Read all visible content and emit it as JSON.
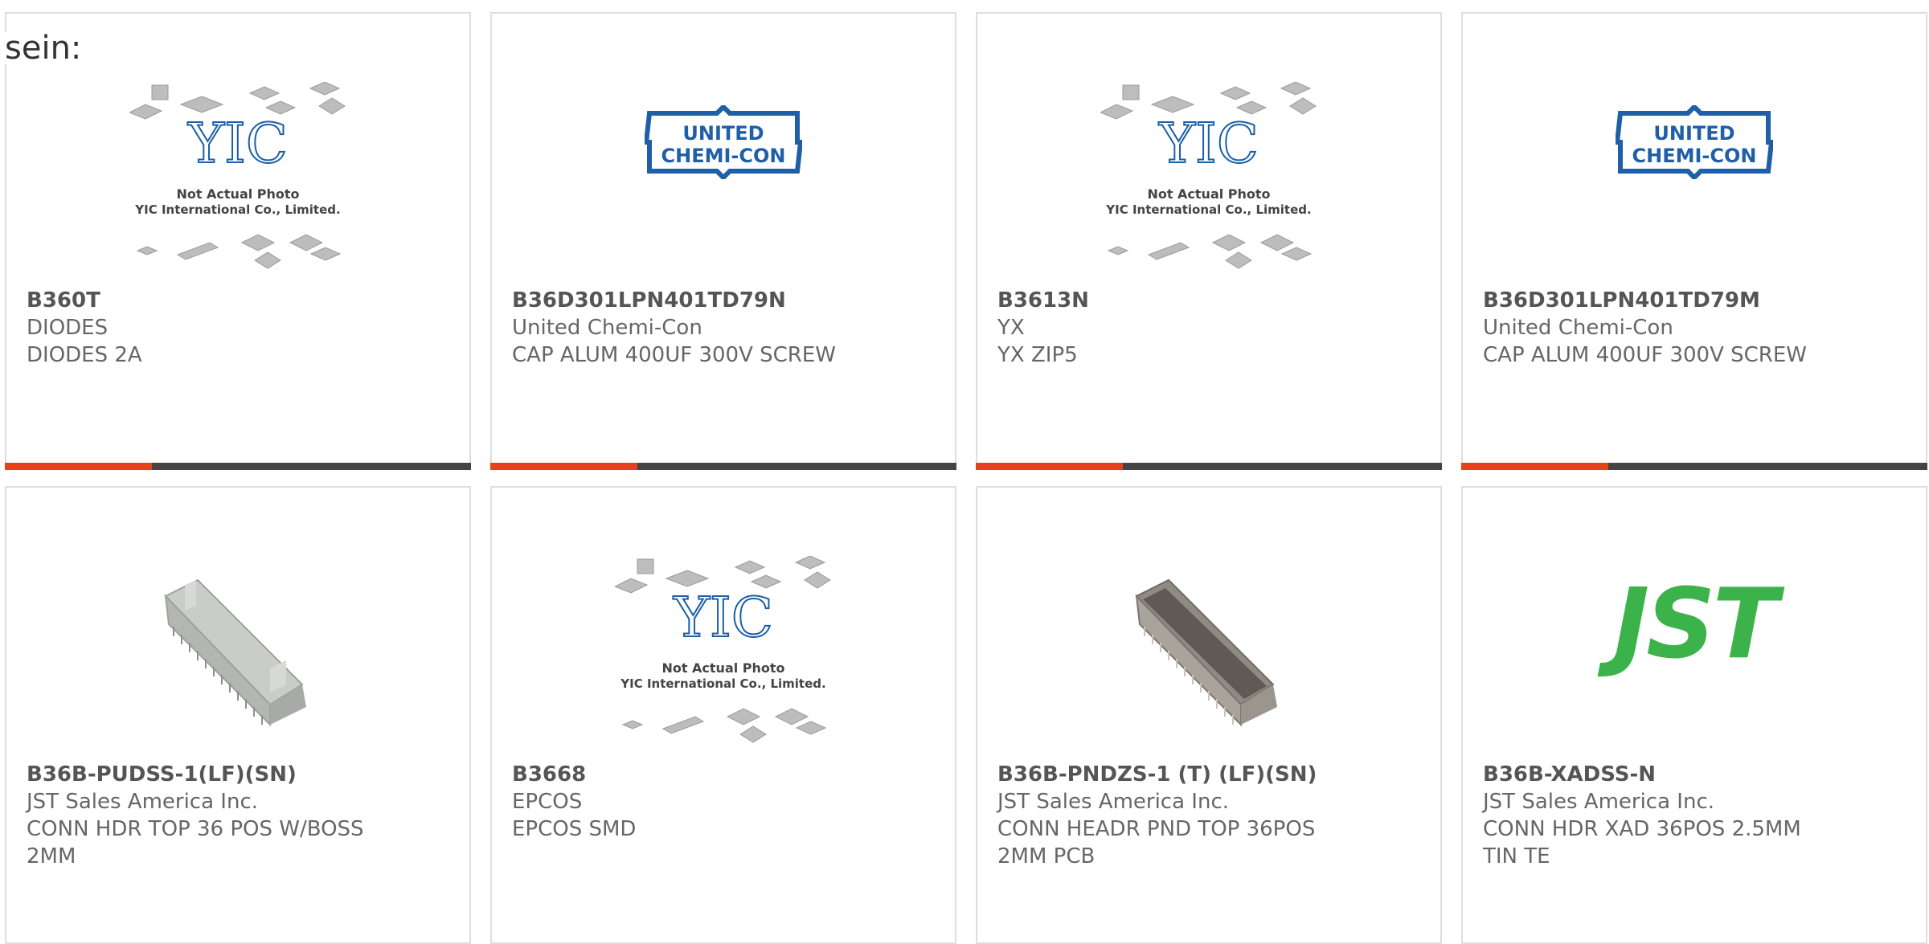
{
  "intro_text": "sein:",
  "logos": {
    "yic_caption_1": "Not Actual Photo",
    "yic_caption_2": "YIC International Co., Limited.",
    "yic_mark": "YIC",
    "chemi_line1": "UNITED",
    "chemi_line2": "CHEMI-CON",
    "jst_mark": "JST"
  },
  "products": [
    {
      "part": "B360T",
      "maker": "DIODES",
      "desc": "DIODES 2A",
      "image": "yic-placeholder"
    },
    {
      "part": "B36D301LPN401TD79N",
      "maker": "United Chemi-Con",
      "desc": "CAP ALUM 400UF 300V SCREW",
      "image": "united-chemi-con-logo"
    },
    {
      "part": "B3613N",
      "maker": "YX",
      "desc": "YX ZIP5",
      "image": "yic-placeholder"
    },
    {
      "part": "B36D301LPN401TD79M",
      "maker": "United Chemi-Con",
      "desc": "CAP ALUM 400UF 300V SCREW",
      "image": "united-chemi-con-logo"
    },
    {
      "part": "B36B-PUDSS-1(LF)(SN)",
      "maker": "JST Sales America Inc.",
      "desc": "CONN HDR TOP 36 POS W/BOSS 2MM",
      "image": "connector-photo"
    },
    {
      "part": "B3668",
      "maker": "EPCOS",
      "desc": "EPCOS SMD",
      "image": "yic-placeholder"
    },
    {
      "part": "B36B-PNDZS-1 (T) (LF)(SN)",
      "maker": "JST Sales America Inc.",
      "desc": "CONN HEADR PND TOP 36POS 2MM PCB",
      "image": "connector-photo-dark"
    },
    {
      "part": "B36B-XADSS-N",
      "maker": "JST Sales America Inc.",
      "desc": "CONN HDR XAD 36POS 2.5MM TIN TE",
      "image": "jst-logo"
    }
  ],
  "colors": {
    "accent": "#e8401c",
    "bar": "#444444",
    "jst_green": "#3bb34a",
    "chemi_blue": "#1f5fa8"
  }
}
